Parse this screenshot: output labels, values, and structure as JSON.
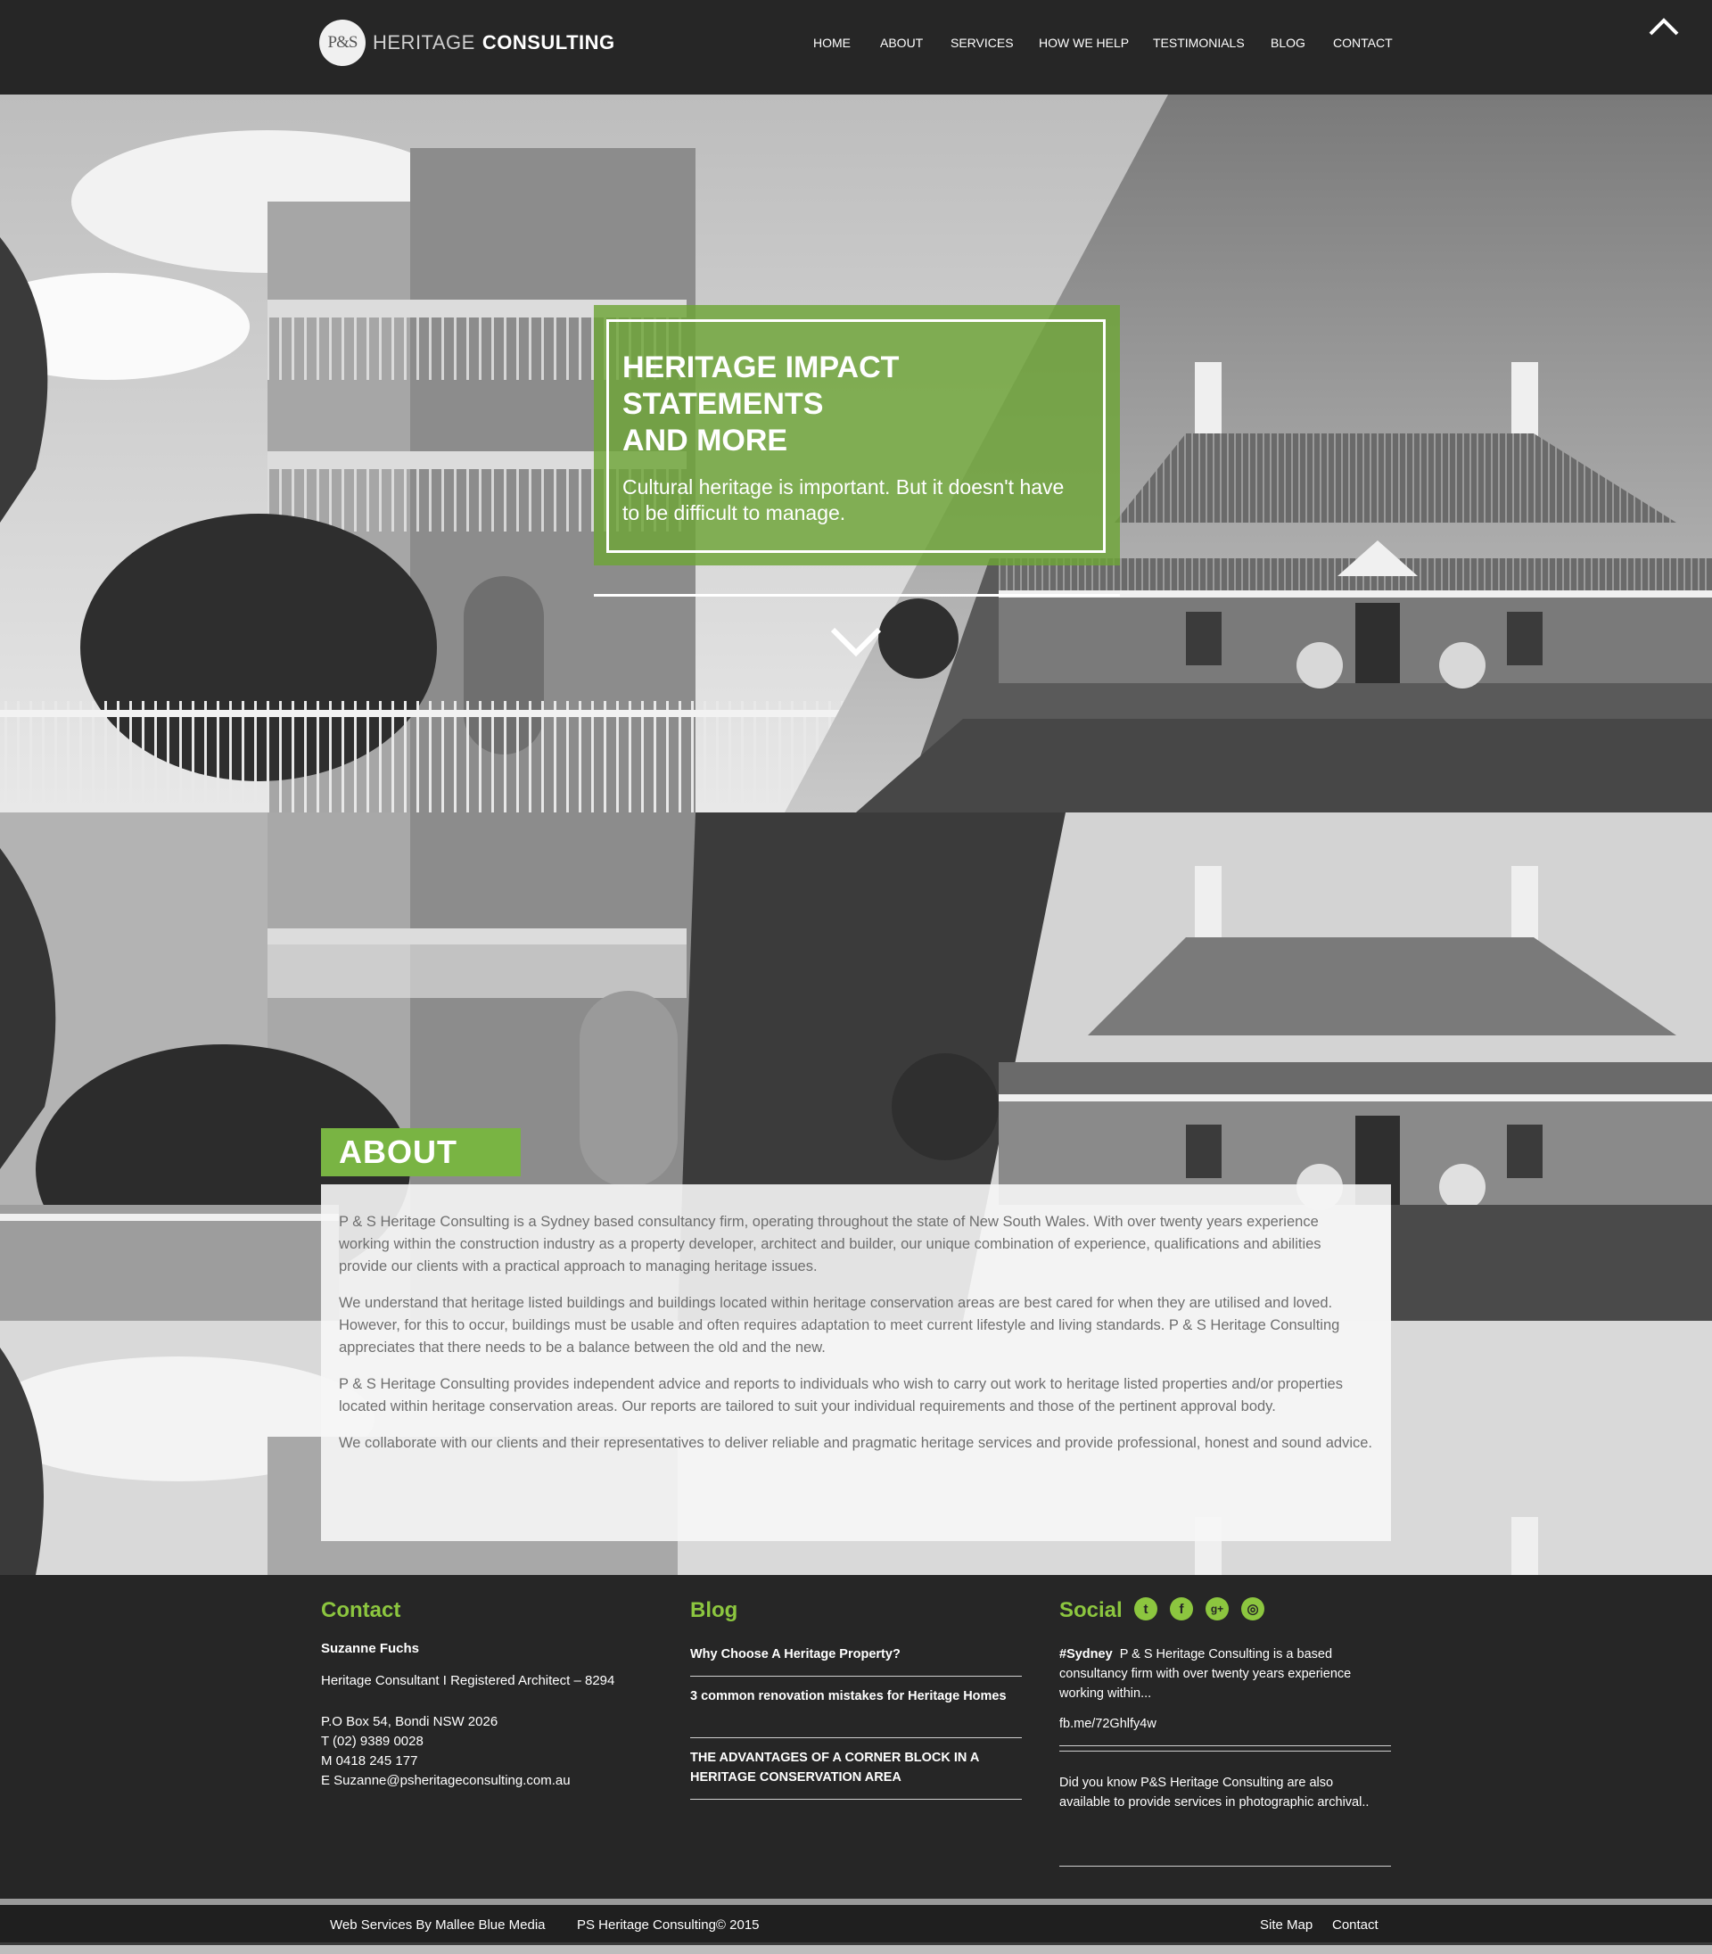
{
  "brand": {
    "logo_mark": "P&S",
    "name_light": "HERITAGE",
    "name_bold": "CONSULTING",
    "accent": "#8cc63f",
    "hero_green": "#6ea537"
  },
  "nav": {
    "items": [
      "HOME",
      "ABOUT",
      "SERVICES",
      "HOW WE HELP",
      "TESTIMONIALS",
      "BLOG",
      "CONTACT"
    ]
  },
  "hero": {
    "title_bold_1": "HERITAGE IMPACT",
    "title_bold_2": "STATEMENTS",
    "title_light": "AND MORE",
    "subtitle": "Cultural heritage is important. But it doesn't have to be difficult to manage."
  },
  "about": {
    "heading": "ABOUT",
    "paragraphs": [
      "P & S Heritage Consulting is a Sydney based consultancy firm, operating throughout the state of New South Wales. With over twenty years experience working within the construction industry as a property developer, architect and builder, our unique combination of experience, qualifications and abilities provide our clients with a practical approach to managing heritage issues.",
      "We understand that heritage listed buildings and buildings located within heritage conservation areas are best cared for when they are utilised and loved. However, for this to occur, buildings must be usable and often requires adaptation to meet current lifestyle and living standards. P & S Heritage Consulting appreciates that there needs to be a balance between the old and the new.",
      "P & S Heritage Consulting provides independent advice and reports to individuals who wish to carry out work to heritage listed properties and/or properties located within heritage conservation areas. Our reports are tailored to suit your individual requirements and those of the pertinent approval body.",
      "We collaborate with our clients and their representatives to deliver reliable and pragmatic heritage services and provide professional, honest and sound advice."
    ]
  },
  "footer": {
    "contact": {
      "heading": "Contact",
      "name": "Suzanne Fuchs",
      "role": "Heritage Consultant I Registered Architect – 8294",
      "address": "P.O Box 54, Bondi NSW 2026",
      "phone": "T (02) 9389 0028",
      "mobile": "M 0418 245 177",
      "email": "E Suzanne@psheritageconsulting.com.au"
    },
    "blog": {
      "heading": "Blog",
      "posts": [
        "Why Choose A Heritage Property?",
        "3 common renovation mistakes for Heritage Homes",
        "THE ADVANTAGES OF A CORNER BLOCK IN A HERITAGE CONSERVATION AREA"
      ]
    },
    "social": {
      "heading": "Social",
      "icons": [
        "twitter-icon",
        "facebook-icon",
        "google-plus-icon",
        "instagram-icon"
      ],
      "icon_glyphs": [
        "t",
        "f",
        "g+",
        "◎"
      ],
      "post1_tag": "#Sydney",
      "post1_text": "P & S Heritage Consulting is a based consultancy firm with over twenty years experience working within...",
      "post1_link": "fb.me/72Ghlfy4w",
      "post2_text": "Did you know P&S Heritage Consulting are also available to provide services in photographic archival.."
    }
  },
  "bottom": {
    "credit": "Web Services By Mallee Blue Media",
    "copyright": "PS Heritage Consulting© 2015",
    "sitemap": "Site Map",
    "contact": "Contact"
  }
}
